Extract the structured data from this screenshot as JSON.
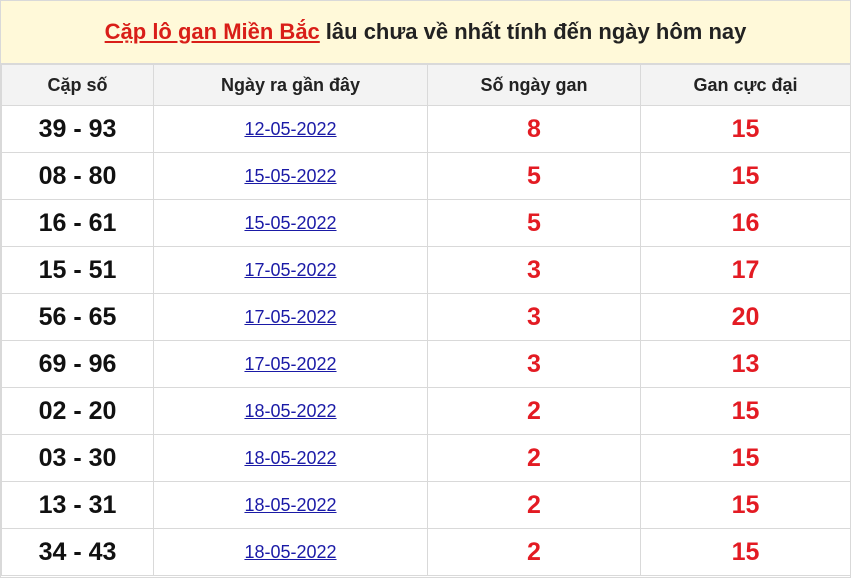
{
  "title": {
    "link_text": "Cặp lô gan Miền Bắc",
    "rest_text": "lâu chưa về nhất tính đến ngày hôm nay"
  },
  "headers": [
    "Cặp số",
    "Ngày ra gần đây",
    "Số ngày gan",
    "Gan cực đại"
  ],
  "rows": [
    {
      "pair": "39 - 93",
      "date": "12-05-2022",
      "days": "8",
      "max": "15"
    },
    {
      "pair": "08 - 80",
      "date": "15-05-2022",
      "days": "5",
      "max": "15"
    },
    {
      "pair": "16 - 61",
      "date": "15-05-2022",
      "days": "5",
      "max": "16"
    },
    {
      "pair": "15 - 51",
      "date": "17-05-2022",
      "days": "3",
      "max": "17"
    },
    {
      "pair": "56 - 65",
      "date": "17-05-2022",
      "days": "3",
      "max": "20"
    },
    {
      "pair": "69 - 96",
      "date": "17-05-2022",
      "days": "3",
      "max": "13"
    },
    {
      "pair": "02 - 20",
      "date": "18-05-2022",
      "days": "2",
      "max": "15"
    },
    {
      "pair": "03 - 30",
      "date": "18-05-2022",
      "days": "2",
      "max": "15"
    },
    {
      "pair": "13 - 31",
      "date": "18-05-2022",
      "days": "2",
      "max": "15"
    },
    {
      "pair": "34 - 43",
      "date": "18-05-2022",
      "days": "2",
      "max": "15"
    }
  ],
  "colors": {
    "accent_red": "#e31b23",
    "link_blue": "#1a1aa6",
    "title_bg": "#fff9d9"
  }
}
